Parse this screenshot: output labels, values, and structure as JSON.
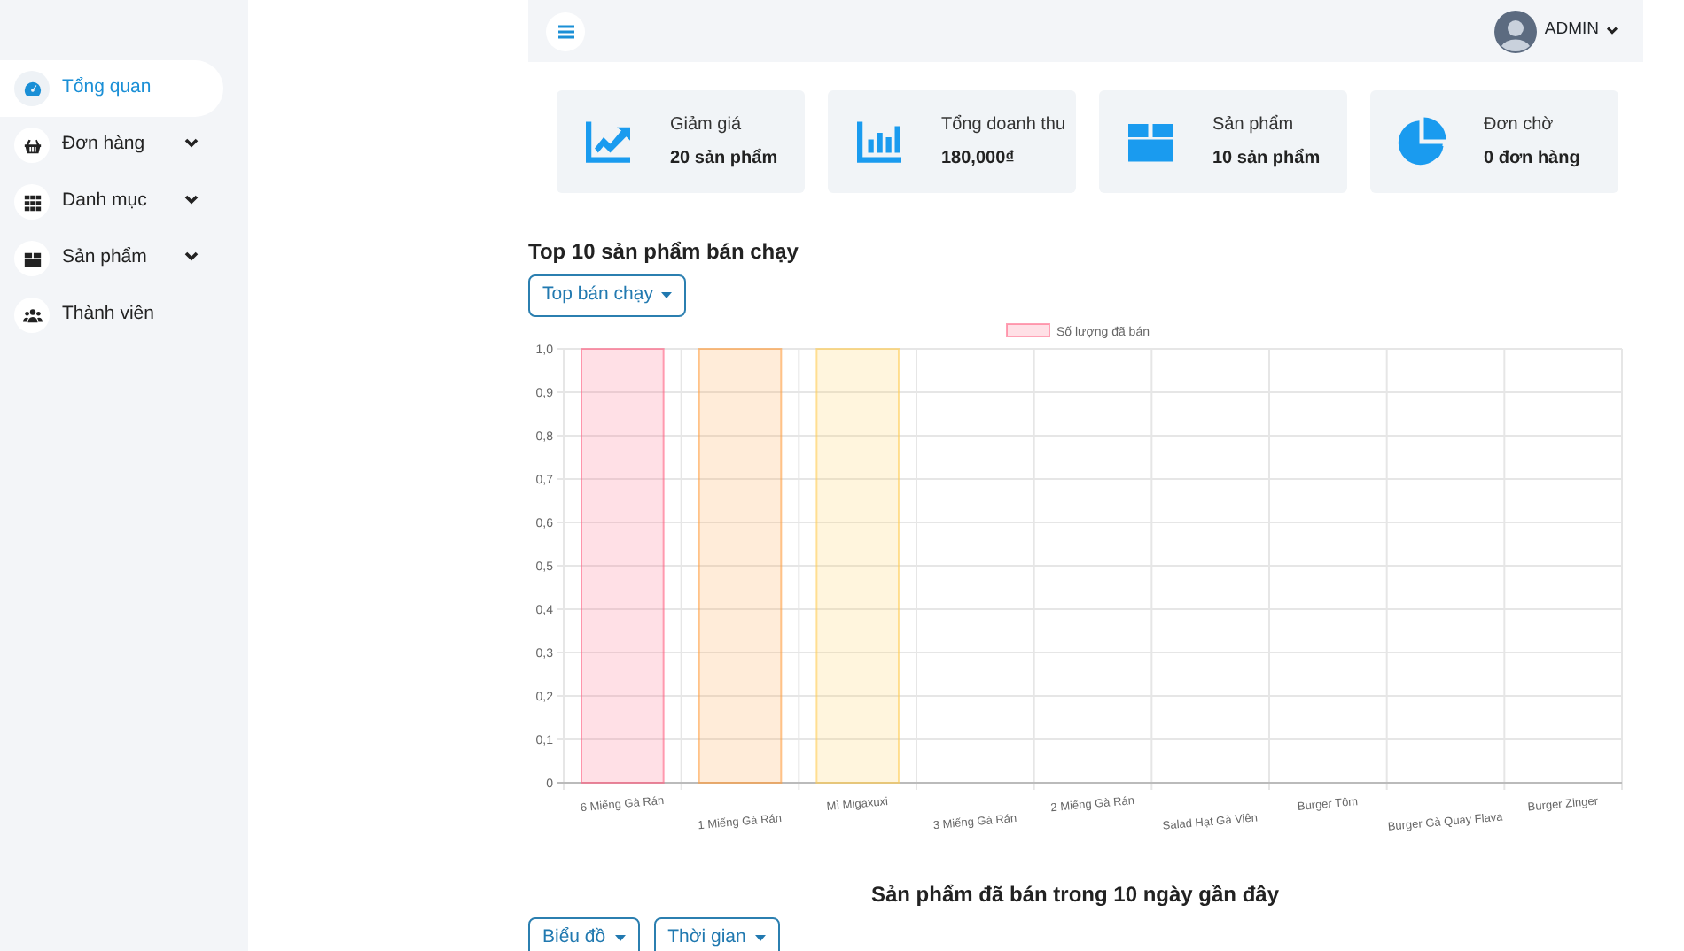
{
  "sidebar": {
    "items": [
      {
        "label": "Tổng quan",
        "selected": true,
        "expandable": false
      },
      {
        "label": "Đơn hàng",
        "selected": false,
        "expandable": true
      },
      {
        "label": "Danh mục",
        "selected": false,
        "expandable": true
      },
      {
        "label": "Sản phẩm",
        "selected": false,
        "expandable": true
      },
      {
        "label": "Thành viên",
        "selected": false,
        "expandable": false
      }
    ]
  },
  "header": {
    "user": "ADMIN"
  },
  "stats": [
    {
      "label": "Giảm giá",
      "value": "20 sản phẩm"
    },
    {
      "label": "Tổng doanh thu",
      "value": "180,000₫"
    },
    {
      "label": "Sản phẩm",
      "value": "10 sản phẩm"
    },
    {
      "label": "Đơn chờ",
      "value": "0 đơn hàng"
    }
  ],
  "top_section": {
    "title": "Top 10 sản phẩm bán chạy",
    "dropdown": "Top bán chạy",
    "chart_data": {
      "type": "bar",
      "categories": [
        "6 Miếng Gà Rán",
        "1 Miếng Gà Rán",
        "Mì Migaxuxi",
        "3 Miếng Gà Rán",
        "2 Miếng Gà Rán",
        "Salad Hạt Gà Viên",
        "Burger Tôm",
        "Burger Gà Quay Flava",
        "Burger Zinger"
      ],
      "series": [
        {
          "name": "Số lượng đã bán",
          "color": "#ff6384",
          "colors": [
            "#ff6384",
            "#ff9f40",
            "#ffcd56",
            null,
            null,
            null,
            null,
            null,
            null
          ],
          "values": [
            1,
            1,
            1,
            0,
            0,
            0,
            0,
            0,
            0
          ]
        }
      ],
      "grid": true,
      "ylim": [
        0,
        1
      ],
      "yticks": [
        {
          "value": 0,
          "label": "0"
        },
        {
          "value": 0.1,
          "label": "0,1"
        },
        {
          "value": 0.2,
          "label": "0,2"
        },
        {
          "value": 0.3,
          "label": "0,3"
        },
        {
          "value": 0.4,
          "label": "0,4"
        },
        {
          "value": 0.5,
          "label": "0,5"
        },
        {
          "value": 0.6,
          "label": "0,6"
        },
        {
          "value": 0.7,
          "label": "0,7"
        },
        {
          "value": 0.8,
          "label": "0,8"
        },
        {
          "value": 0.9,
          "label": "0,9"
        },
        {
          "value": 1,
          "label": "1,0"
        }
      ]
    }
  },
  "recent_section": {
    "title": "Sản phẩm đã bán trong 10 ngày gần đây",
    "dropdowns": [
      "Biểu đồ",
      "Thời gian"
    ]
  }
}
